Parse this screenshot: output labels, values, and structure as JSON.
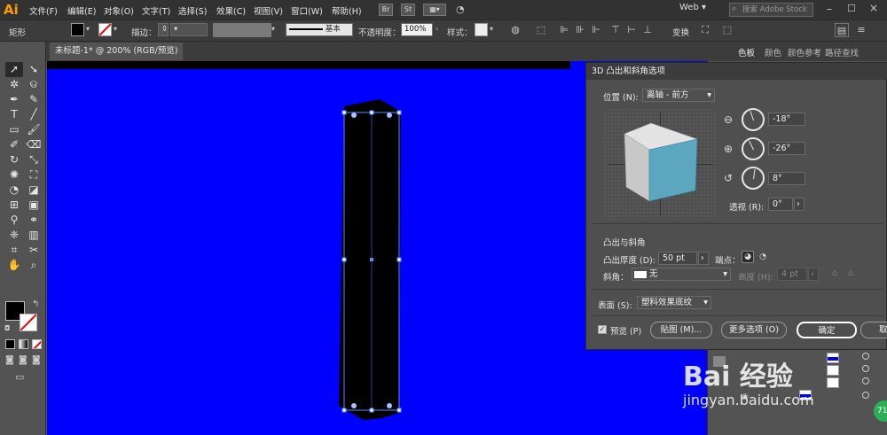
{
  "app": {
    "logo": "Ai",
    "menus": [
      "文件(F)",
      "编辑(E)",
      "对象(O)",
      "文字(T)",
      "选择(S)",
      "效果(C)",
      "视图(V)",
      "窗口(W)",
      "帮助(H)"
    ],
    "bridge_btn": "Br",
    "stock_btn": "St",
    "workspace": "Web",
    "search_placeholder": "搜索 Adobe Stock"
  },
  "control_bar": {
    "object_type": "矩形",
    "stroke_label": "描边：",
    "stroke_style": "基本",
    "opacity_label": "不透明度：",
    "opacity_value": "100%",
    "style_label": "样式：",
    "transform_label": "变换"
  },
  "document": {
    "tab_title": "未标题-1* @ 200% (RGB/预览)",
    "close": "×",
    "canvas_color": "#0000ff"
  },
  "right_panel": {
    "tabs": [
      "色板",
      "颜色",
      "颜色参考",
      "路径查找"
    ]
  },
  "dialog_3d": {
    "title": "3D 凸出和斜角选项",
    "position_label": "位置 (N):",
    "position_value": "离轴 - 前方",
    "rot_x": "-18°",
    "rot_y": "-26°",
    "rot_z": "8°",
    "perspective_label": "透视 (R):",
    "perspective_value": "0°",
    "extrude_section": "凸出与斜角",
    "extrude_depth_label": "凸出厚度 (D):",
    "extrude_depth_value": "50 pt",
    "cap_label": "端点：",
    "bevel_label": "斜角：",
    "bevel_value": "无",
    "height_label": "高度 (H):",
    "height_value": "4 pt",
    "surface_label": "表面 (S):",
    "surface_value": "塑料效果底纹",
    "preview_label": "预览 (P)",
    "map_button": "贴图 (M)...",
    "more_options_button": "更多选项 (O)",
    "ok_button": "确定",
    "cancel_button": "取"
  },
  "watermark": {
    "brand": "Bai 经验",
    "url": "jingyan.baidu.com"
  },
  "colors": {
    "cube_front": "#5ba7c0",
    "cube_top": "#e3e3e3",
    "cube_side": "#c8c8c8",
    "accent": "#ff9a00"
  }
}
